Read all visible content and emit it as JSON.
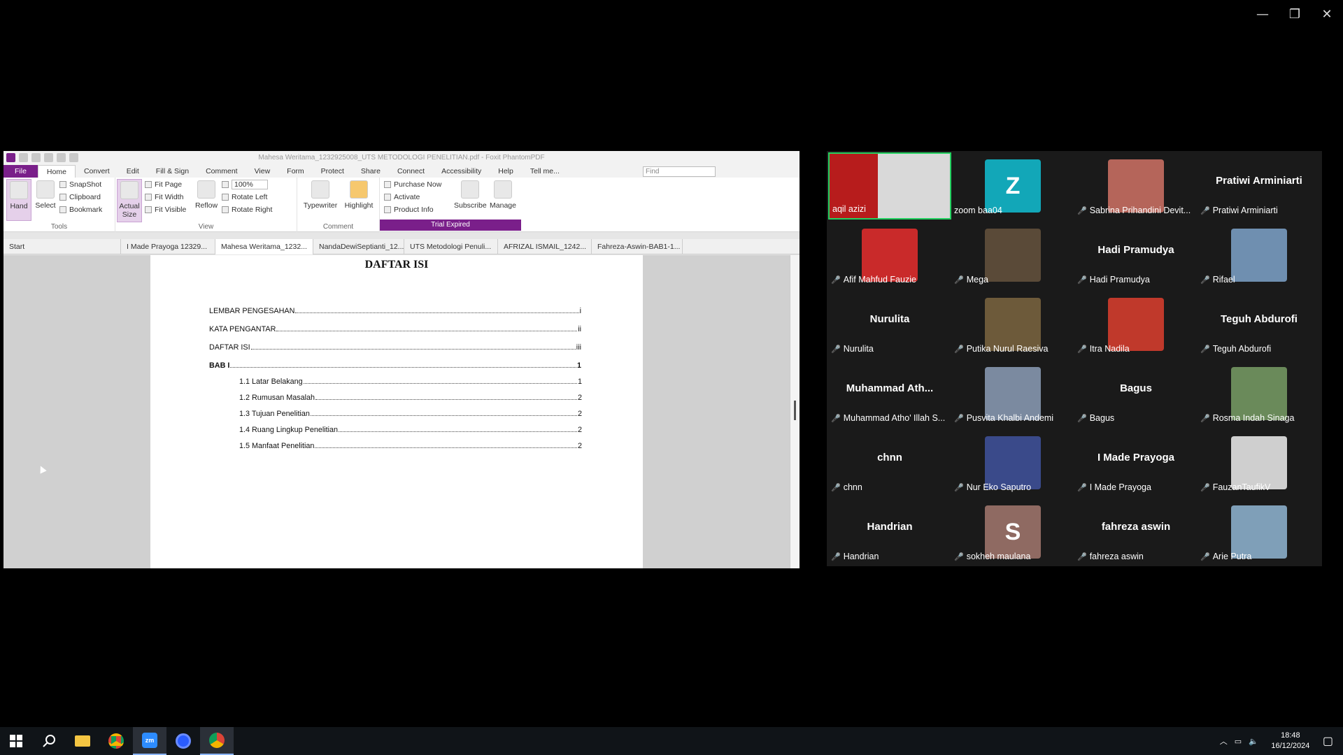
{
  "window_controls": {
    "minimize": "—",
    "maximize": "❐",
    "close": "✕"
  },
  "pdf": {
    "title": "Mahesa Weritama_1232925008_UTS METODOLOGI PENELITIAN.pdf - Foxit PhantomPDF",
    "menu": [
      "File",
      "Home",
      "Convert",
      "Edit",
      "Fill & Sign",
      "Comment",
      "View",
      "Form",
      "Protect",
      "Share",
      "Connect",
      "Accessibility",
      "Help",
      "Tell me..."
    ],
    "find_placeholder": "Find",
    "ribbon": {
      "hand": "Hand",
      "select": "Select",
      "snapshot": "SnapShot",
      "clipboard": "Clipboard",
      "bookmark": "Bookmark",
      "actual_size": "Actual Size",
      "fit_page": "Fit Page",
      "fit_width": "Fit Width",
      "fit_visible": "Fit Visible",
      "reflow": "Reflow",
      "zoom": "100%",
      "rotate_left": "Rotate Left",
      "rotate_right": "Rotate Right",
      "typewriter": "Typewriter",
      "highlight": "Highlight",
      "purchase": "Purchase Now",
      "activate": "Activate",
      "product_info": "Product Info",
      "subscribe": "Subscribe",
      "manage": "Manage",
      "group_tools": "Tools",
      "group_view": "View",
      "group_comment": "Comment",
      "trial": "Trial Expired"
    },
    "tabs": [
      "Start",
      "I Made Prayoga 12329...",
      "Mahesa Weritama_1232...",
      "NandaDewiSeptianti_12...",
      "UTS Metodologi Penuli...",
      "AFRIZAL ISMAIL_1242...",
      "Fahreza-Aswin-BAB1-1..."
    ],
    "toc_title": "DAFTAR ISI",
    "toc": [
      {
        "label": "LEMBAR PENGESAHAN",
        "page": "i"
      },
      {
        "label": "KATA PENGANTAR",
        "page": "ii"
      },
      {
        "label": "DAFTAR ISI",
        "page": "iii"
      },
      {
        "label": "BAB I",
        "page": "1"
      },
      {
        "label": "1.1 Latar Belakang",
        "page": "1"
      },
      {
        "label": "1.2 Rumusan Masalah",
        "page": "2"
      },
      {
        "label": "1.3 Tujuan Penelitian",
        "page": "2"
      },
      {
        "label": "1.4 Ruang Lingkup Penelitian",
        "page": "2"
      },
      {
        "label": "1.5 Manfaat Penelitian",
        "page": "2"
      }
    ]
  },
  "participants": [
    {
      "name": "aqil azizi",
      "big": "",
      "letter": "",
      "color": "#6b3a3a"
    },
    {
      "name": "zoom baa04",
      "big": "",
      "letter": "Z",
      "color": "#12a7b8"
    },
    {
      "name": "Sabrina Prihandini Devit...",
      "big": "",
      "letter": "",
      "color": "#b5655a"
    },
    {
      "name": "Pratiwi Arminiarti",
      "big": "Pratiwi Arminiarti",
      "letter": "",
      "color": ""
    },
    {
      "name": "Afif Mahfud Fauzie",
      "big": "",
      "letter": "",
      "color": "#c92a2a"
    },
    {
      "name": "Mega",
      "big": "",
      "letter": "",
      "color": "#5a4a38"
    },
    {
      "name": "Hadi Pramudya",
      "big": "Hadi Pramudya",
      "letter": "",
      "color": ""
    },
    {
      "name": "Rifael",
      "big": "",
      "letter": "",
      "color": "#6f8fb0"
    },
    {
      "name": "Nurulita",
      "big": "Nurulita",
      "letter": "",
      "color": ""
    },
    {
      "name": "Putika Nurul Raesiva",
      "big": "",
      "letter": "",
      "color": "#6d5a3a"
    },
    {
      "name": "Itra Nadila",
      "big": "",
      "letter": "",
      "color": "#c0392b"
    },
    {
      "name": "Teguh Abdurofi",
      "big": "Teguh Abdurofi",
      "letter": "",
      "color": ""
    },
    {
      "name": "Muhammad Atho' Illah S...",
      "big": "Muhammad  Ath...",
      "letter": "",
      "color": ""
    },
    {
      "name": "Pusvita Khalbi Andemi",
      "big": "",
      "letter": "",
      "color": "#7b8aa0"
    },
    {
      "name": "Bagus",
      "big": "Bagus",
      "letter": "",
      "color": ""
    },
    {
      "name": "Rosma Indah Sinaga",
      "big": "",
      "letter": "",
      "color": "#6a8a5a"
    },
    {
      "name": "chnn",
      "big": "chnn",
      "letter": "",
      "color": ""
    },
    {
      "name": "Nur Eko Saputro",
      "big": "",
      "letter": "",
      "color": "#3a4a8a"
    },
    {
      "name": "I Made Prayoga",
      "big": "I Made Prayoga",
      "letter": "",
      "color": ""
    },
    {
      "name": "FauzanTaufikV",
      "big": "",
      "letter": "",
      "color": "#cfcfcf"
    },
    {
      "name": "Handrian",
      "big": "Handrian",
      "letter": "",
      "color": ""
    },
    {
      "name": "sokheh maulana",
      "big": "",
      "letter": "S",
      "color": "#8f6a62"
    },
    {
      "name": "fahreza aswin",
      "big": "fahreza aswin",
      "letter": "",
      "color": ""
    },
    {
      "name": "Arie Putra",
      "big": "",
      "letter": "",
      "color": "#7f9fb8"
    }
  ],
  "mute_icon": "muted-mic-icon",
  "clock": {
    "time": "18:48",
    "date": "16/12/2024"
  }
}
